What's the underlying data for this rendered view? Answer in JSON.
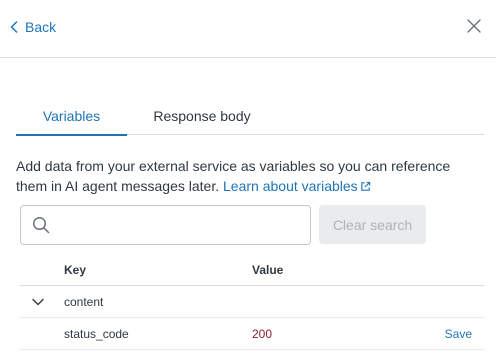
{
  "header": {
    "back_label": "Back"
  },
  "tabs": [
    {
      "label": "Variables",
      "active": true
    },
    {
      "label": "Response body",
      "active": false
    }
  ],
  "description": {
    "text": "Add data from your external service as variables so you can reference them in AI agent messages later. ",
    "link_label": "Learn about variables"
  },
  "search": {
    "placeholder": "",
    "value": "",
    "clear_label": "Clear search"
  },
  "table": {
    "columns": {
      "key": "Key",
      "value": "Value"
    },
    "rows": [
      {
        "key": "content",
        "value": "",
        "expanded": true
      },
      {
        "key": "status_code",
        "value": "200",
        "action": "Save"
      }
    ]
  },
  "colors": {
    "accent": "#1f73b7",
    "value_text": "#8c232c",
    "divider": "#d8dcde"
  },
  "icons": [
    "chevron-left-icon",
    "close-icon",
    "external-link-icon",
    "search-icon",
    "chevron-down-icon"
  ]
}
